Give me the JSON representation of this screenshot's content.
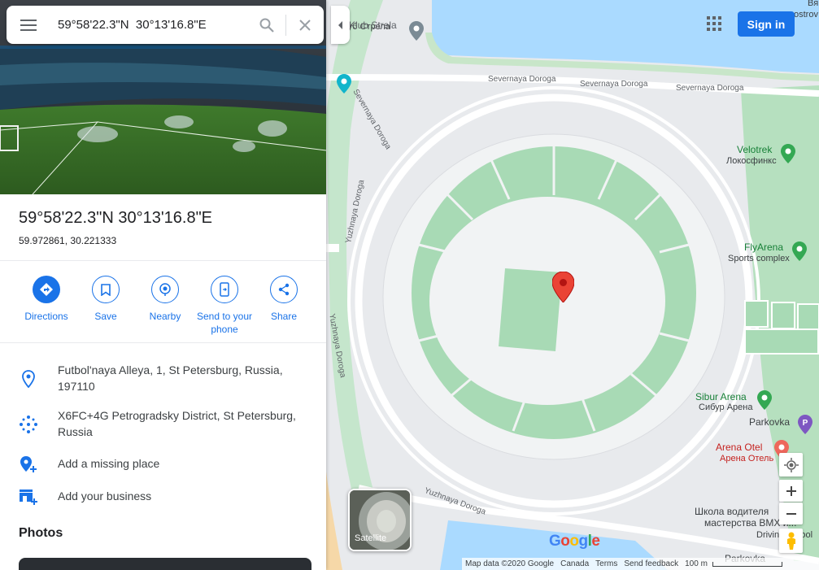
{
  "search": {
    "query": "59°58'22.3\"N  30°13'16.8\"E"
  },
  "place": {
    "title": "59°58'22.3\"N 30°13'16.8\"E",
    "decimal_coords": "59.972861, 30.221333"
  },
  "actions": [
    {
      "label": "Directions",
      "icon": "directions-icon"
    },
    {
      "label": "Save",
      "icon": "bookmark-icon"
    },
    {
      "label": "Nearby",
      "icon": "nearby-icon"
    },
    {
      "label": "Send to your phone",
      "icon": "send-to-phone-icon"
    },
    {
      "label": "Share",
      "icon": "share-icon"
    }
  ],
  "info": {
    "address": "Futbol'naya Alleya, 1, St Petersburg, Russia, 197110",
    "plus_code": "X6FC+4G Petrogradsky District, St Petersburg, Russia",
    "add_missing_place": "Add a missing place",
    "add_business": "Add your business"
  },
  "photos_heading": "Photos",
  "header": {
    "sign_in": "Sign in"
  },
  "map": {
    "labels": {
      "klub_strela": "Klub Strela",
      "klub_strela_ru": "й клуб Стрела",
      "ostrov": "ostrov",
      "ostrov_top": "Вя",
      "severnaya_1": "Severnaya Doroga",
      "severnaya_2": "Severnaya Doroga",
      "severnaya_3": "Severnaya Doroga",
      "severnaya_4": "Severnaya Doroga",
      "yuzhnaya_1": "Yuzhnaya Doroga",
      "yuzhnaya_2": "Yuzhnaya Doroga",
      "yuzhnaya_3": "Yuzhnaya Doroga",
      "velotrek": "Velotrek",
      "velotrek_ru": "Локосфинкс",
      "flyarena": "FlyArena",
      "flyarena_sub": "Sports complex",
      "sibur": "Sibur Arena",
      "sibur_ru": "Сибур Арена",
      "parkovka_1": "Parkovka",
      "arena_otel": "Arena Otel",
      "arena_otel_ru": "Арена Отель",
      "shkola_1": "Школа водителя",
      "shkola_2": "мастерства ВМХ и...",
      "driving_school": "Driving school",
      "parkovka_2": "Parkovka"
    },
    "satellite_label": "Satellite",
    "google_logo": "Google"
  },
  "footer": {
    "map_data": "Map data ©2020 Google",
    "region": "Canada",
    "terms": "Terms",
    "feedback": "Send feedback",
    "scale": "100 m"
  },
  "colors": {
    "accent": "#1a73e8",
    "map_bg": "#e8eaed",
    "park_green": "#a8dab5",
    "water": "#aadaff",
    "pin_red": "#ea4335"
  }
}
